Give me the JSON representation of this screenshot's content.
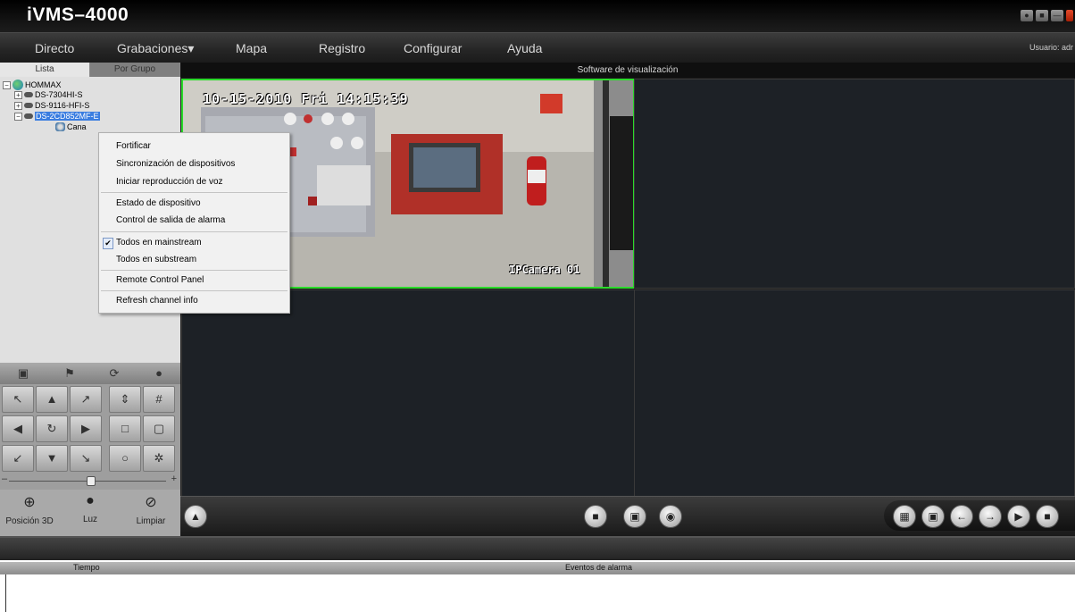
{
  "app": {
    "title": "iVMS–4000"
  },
  "menu": {
    "items": [
      "Directo",
      "Grabaciones▾",
      "Mapa",
      "Registro",
      "Configurar",
      "Ayuda"
    ],
    "user": "Usuario: adr"
  },
  "left_panel": {
    "tabs": [
      "Lista",
      "Por Grupo"
    ],
    "tree": [
      {
        "label": "HOMMAX",
        "icon": "globe-icon"
      },
      {
        "label": "DS-7304HI-S",
        "icon": "dvr-icon"
      },
      {
        "label": "DS-9116-HFI-S",
        "icon": "dvr-icon"
      },
      {
        "label": "DS-2CD852MF-E",
        "icon": "dvr-icon",
        "selected": true
      },
      {
        "label": "Cana",
        "icon": "camera-icon"
      }
    ],
    "bottom_buttons": [
      {
        "label": "Posición 3D",
        "icon": "zoom-icon"
      },
      {
        "label": "Luz",
        "icon": "light-icon"
      },
      {
        "label": "Limpiar",
        "icon": "wiper-icon"
      }
    ]
  },
  "context_menu": {
    "items": [
      "Fortificar",
      "Sincronización de dispositivos",
      "Iniciar reproducción de voz",
      "Estado de dispositivo",
      "Control de salida de alarma",
      "Todos en mainstream",
      "Todos en substream",
      "Remote Control Panel",
      "Refresh channel info"
    ],
    "checked_item": "Todos en mainstream"
  },
  "video": {
    "title": "Software de visualización",
    "osd_date": "10-15-2010 Fri 14:15:39",
    "osd_camera": "IPCamera 01",
    "accent_border": "#2bdb2b"
  },
  "alarm": {
    "columns": [
      "Tiempo",
      "Eventos de alarma"
    ]
  }
}
